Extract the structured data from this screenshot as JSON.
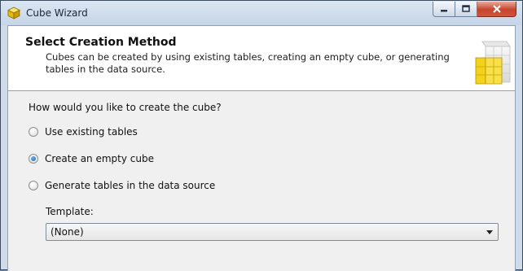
{
  "window": {
    "title": "Cube Wizard",
    "icon": "cube-icon"
  },
  "header": {
    "title": "Select Creation Method",
    "description": "Cubes can be created by using existing tables, creating an empty cube, or generating tables in the data source.",
    "graphic": "cube-graphic"
  },
  "question": "How would you like to create the cube?",
  "options": [
    {
      "label": "Use existing tables",
      "selected": false
    },
    {
      "label": "Create an empty cube",
      "selected": true
    },
    {
      "label": "Generate tables in the data source",
      "selected": false
    }
  ],
  "template": {
    "label": "Template:",
    "value": "(None)"
  },
  "colors": {
    "accent": "#1b5fa5",
    "close": "#c6452c",
    "cube": "#f2d21b"
  }
}
